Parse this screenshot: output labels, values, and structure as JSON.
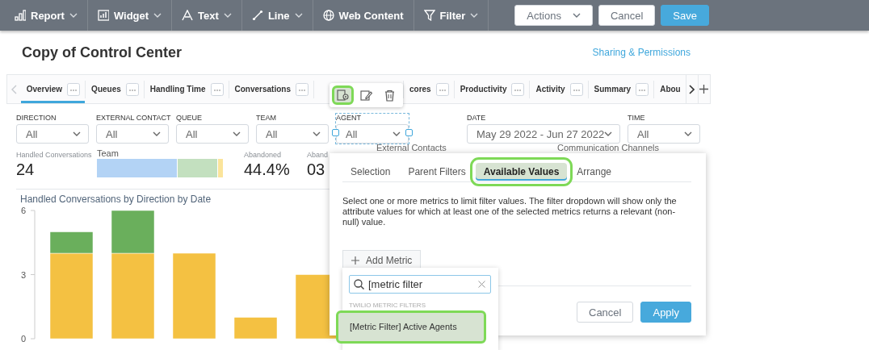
{
  "toolbar": {
    "menus": [
      {
        "label": "Report",
        "dropdown": true
      },
      {
        "label": "Widget",
        "dropdown": true
      },
      {
        "label": "Text",
        "dropdown": true
      },
      {
        "label": "Line",
        "dropdown": true
      },
      {
        "label": "Web Content",
        "dropdown": false
      },
      {
        "label": "Filter",
        "dropdown": true
      }
    ],
    "actions": [
      {
        "label": "Actions",
        "kind": "dropdown"
      },
      {
        "label": "Cancel",
        "kind": "secondary"
      },
      {
        "label": "Save",
        "kind": "primary"
      }
    ]
  },
  "title": "Copy of Control Center",
  "sharing_link": "Sharing & Permissions",
  "tabs": [
    {
      "label": "Overview",
      "selected": true
    },
    {
      "label": "Queues",
      "selected": false
    },
    {
      "label": "Handling Time",
      "selected": false
    },
    {
      "label": "Conversations",
      "selected": false
    },
    {
      "label": "cores",
      "selected": false
    },
    {
      "label": "Productivity",
      "selected": false
    },
    {
      "label": "Activity",
      "selected": false
    },
    {
      "label": "Summary",
      "selected": false
    },
    {
      "label": "Abou",
      "selected": false
    }
  ],
  "tab_tools": [
    {
      "highlighted": true
    },
    {
      "highlighted": false
    },
    {
      "highlighted": false
    }
  ],
  "filters": [
    {
      "label": "DIRECTION",
      "value": "All",
      "kind": "select",
      "selected": false
    },
    {
      "label": "EXTERNAL CONTACT",
      "value": "All",
      "kind": "select",
      "selected": false
    },
    {
      "label": "QUEUE",
      "value": "All",
      "kind": "select",
      "selected": false
    },
    {
      "label": "TEAM",
      "value": "All",
      "kind": "select",
      "selected": false
    },
    {
      "label": "AGENT",
      "value": "All",
      "kind": "select",
      "selected": true
    },
    {
      "label": "DATE",
      "value": "May 29 2022 - Jun 27 2022",
      "kind": "date",
      "selected": false
    },
    {
      "label": "TIME",
      "value": "All",
      "kind": "select",
      "selected": false
    }
  ],
  "kpis": [
    {
      "kind": "number",
      "label": "Handled Conversations",
      "value": "24"
    },
    {
      "kind": "bar",
      "label": "Team"
    },
    {
      "kind": "number",
      "label": "Abandoned",
      "value": "44.4%"
    },
    {
      "kind": "number",
      "label": "Aband",
      "value": "03"
    }
  ],
  "widget_labels": [
    "External Contacts",
    "Communication Channels"
  ],
  "chart": {
    "title": "Handled Conversations by Direction by Date",
    "chart_data": {
      "type": "bar",
      "stacked": true,
      "ylim": [
        0,
        6
      ],
      "yticks": [
        0,
        3,
        6
      ],
      "series": [
        {
          "color": "#f4c142",
          "values": [
            4,
            4,
            4,
            1,
            3
          ]
        },
        {
          "color": "#6aaf5c",
          "values": [
            1,
            2,
            0,
            0,
            0
          ]
        }
      ]
    }
  },
  "filter_popup": {
    "tabs": [
      {
        "label": "Selection",
        "selected": false,
        "highlighted": false
      },
      {
        "label": "Parent Filters",
        "selected": false,
        "highlighted": false
      },
      {
        "label": "Available Values",
        "selected": true,
        "highlighted": true
      },
      {
        "label": "Arrange",
        "selected": false,
        "highlighted": false
      }
    ],
    "description": "Select one or more metrics to limit filter values. The filter dropdown will show only the attribute values for which at least one of the selected metrics returns a relevant (non-null) value.",
    "add_metric": "Add Metric",
    "buttons": [
      {
        "label": "Cancel",
        "kind": "secondary"
      },
      {
        "label": "Apply",
        "kind": "primary"
      }
    ]
  },
  "metric_dropdown": {
    "search": {
      "value": "[metric filter"
    },
    "section": "TWILIO METRIC FILTERS",
    "items": [
      {
        "label": "[Metric Filter] Active Agents",
        "highlighted": true
      }
    ]
  }
}
